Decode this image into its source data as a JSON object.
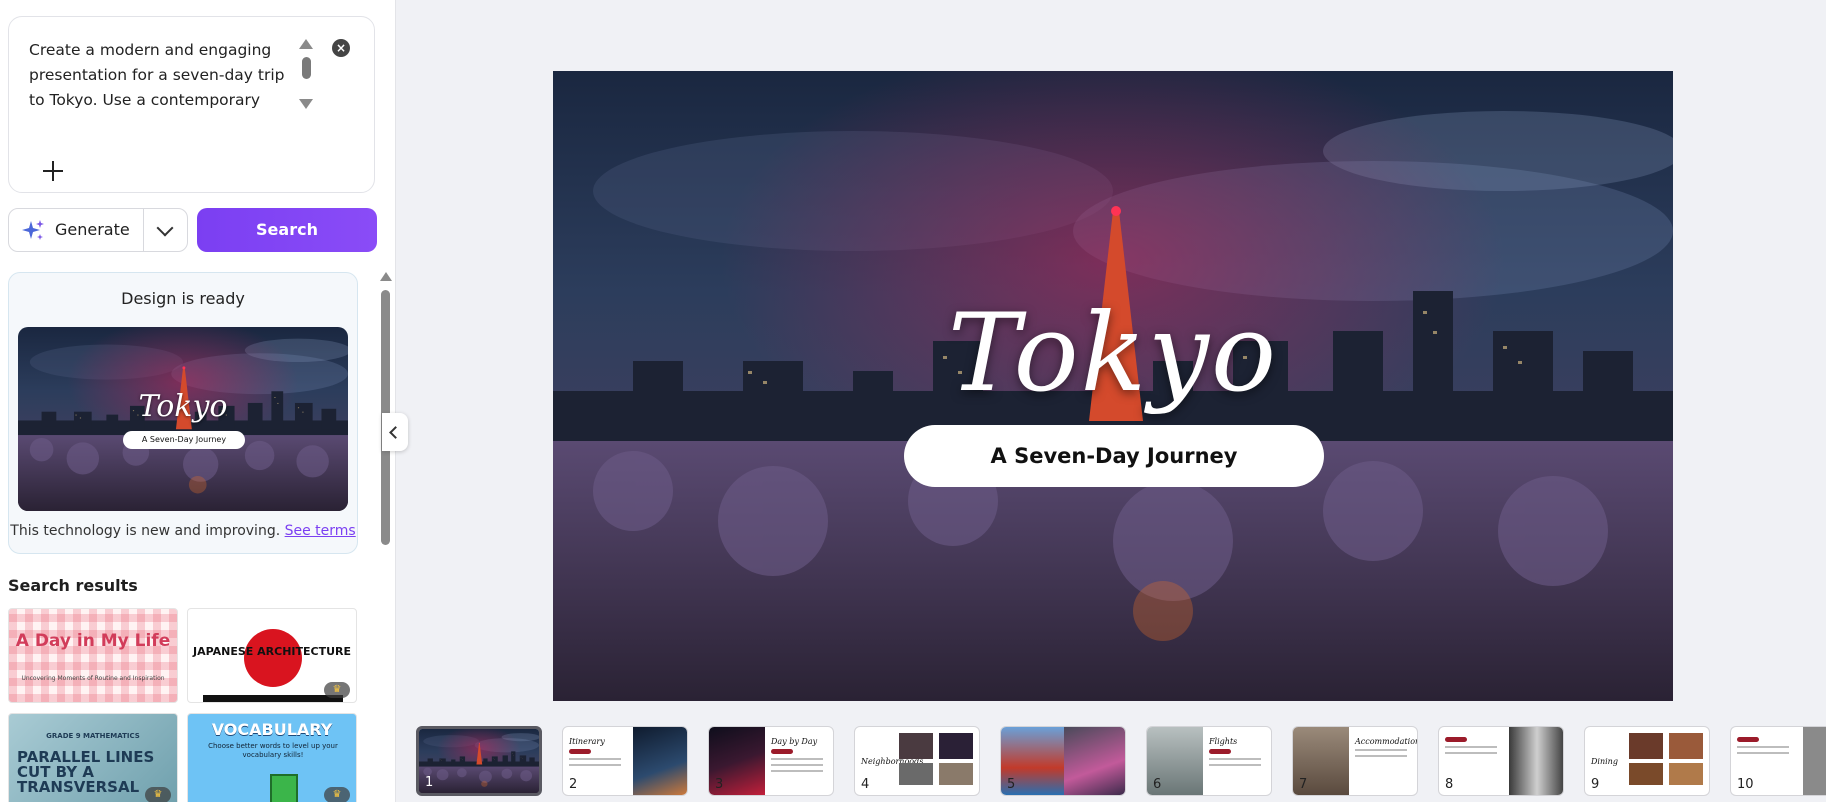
{
  "prompt": {
    "text": "Create a modern and engaging presentation for a seven-day trip to Tokyo. Use a contemporary"
  },
  "actions": {
    "generate_label": "Generate",
    "search_label": "Search"
  },
  "design_card": {
    "title": "Design is ready",
    "thumb_title": "Tokyo",
    "thumb_subtitle": "A Seven-Day Journey",
    "disclaimer": "This technology is new and improving.",
    "terms_link": "See terms"
  },
  "search_results": {
    "heading": "Search results",
    "items": [
      {
        "title": "A Day in My Life",
        "subtitle": "Uncovering Moments of Routine and Inspiration"
      },
      {
        "title": "JAPANESE ARCHITECTURE"
      },
      {
        "tag": "GRADE 9 MATHEMATICS",
        "title": "PARALLEL LINES CUT BY A TRANSVERSAL"
      },
      {
        "title": "VOCABULARY",
        "subtitle": "Choose better words to level up your vocabulary skills!"
      }
    ]
  },
  "slide": {
    "title": "Tokyo",
    "subtitle": "A Seven-Day Journey"
  },
  "filmstrip": {
    "pages": [
      {
        "number": "1",
        "selected": true
      },
      {
        "number": "2",
        "label": "Itinerary"
      },
      {
        "number": "3",
        "label": "Day by Day"
      },
      {
        "number": "4",
        "label": "Neighborhoods"
      },
      {
        "number": "5"
      },
      {
        "number": "6",
        "label": "Flights"
      },
      {
        "number": "7",
        "label": "Accommodation"
      },
      {
        "number": "8"
      },
      {
        "number": "9",
        "label": "Dining"
      },
      {
        "number": "10"
      }
    ]
  },
  "colors": {
    "accent": "#7b3ff2",
    "slide_red": "#9b1b2a"
  },
  "icons": {
    "clear": "close-circle-icon",
    "add": "plus-icon",
    "generate": "sparkle-icon",
    "dropdown": "chevron-down-icon",
    "collapse": "chevron-left-icon",
    "premium": "crown-icon"
  }
}
